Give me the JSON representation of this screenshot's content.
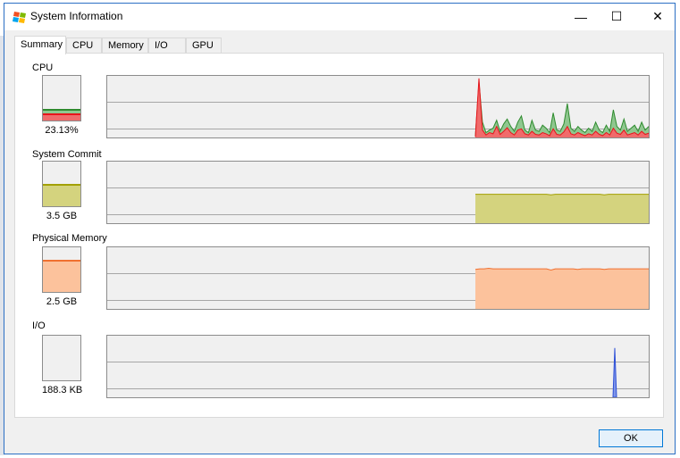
{
  "window": {
    "title": "System Information",
    "icon": "system-info-icon"
  },
  "caption_buttons": {
    "minimize": "—",
    "maximize": "☐",
    "close": "✕"
  },
  "tabs": [
    {
      "label": "Summary",
      "active": true
    },
    {
      "label": "CPU",
      "active": false
    },
    {
      "label": "Memory",
      "active": false
    },
    {
      "label": "I/O",
      "active": false
    },
    {
      "label": "GPU",
      "active": false
    }
  ],
  "sections": {
    "cpu": {
      "label": "CPU",
      "value": "23.13%",
      "level": 0.23,
      "kernel_level": 0.12
    },
    "commit": {
      "label": "System Commit",
      "value": "3.5 GB",
      "level": 0.47
    },
    "physical": {
      "label": "Physical Memory",
      "value": "2.5 GB",
      "level": 0.69
    },
    "io": {
      "label": "I/O",
      "value": "188.3  KB",
      "level": 0
    }
  },
  "colors": {
    "cpu_total": "#2e8b2e",
    "cpu_total_fill": "#8fc78f",
    "cpu_kernel": "#e8141b",
    "cpu_kernel_fill": "#f06b6b",
    "commit_line": "#a3a000",
    "commit_fill": "#d4d37e",
    "physical_line": "#f07030",
    "physical_fill": "#fcc29c",
    "io_line": "#2c4fd6"
  },
  "history": {
    "cpu_total": [
      2,
      90,
      25,
      8,
      12,
      15,
      28,
      10,
      22,
      30,
      18,
      10,
      25,
      35,
      12,
      8,
      28,
      12,
      10,
      20,
      15,
      8,
      40,
      12,
      10,
      22,
      55,
      15,
      10,
      18,
      12,
      8,
      15,
      10,
      25,
      12,
      8,
      20,
      10,
      45,
      18,
      12,
      30,
      10,
      15,
      20,
      10,
      25,
      12,
      18
    ],
    "cpu_kernel": [
      1,
      96,
      12,
      4,
      8,
      6,
      18,
      5,
      10,
      16,
      8,
      4,
      12,
      14,
      6,
      4,
      10,
      5,
      4,
      8,
      6,
      3,
      14,
      5,
      4,
      9,
      18,
      6,
      4,
      8,
      5,
      3,
      6,
      4,
      10,
      5,
      3,
      8,
      4,
      15,
      7,
      5,
      12,
      4,
      6,
      8,
      4,
      10,
      5,
      7
    ],
    "commit": [
      0.47,
      0.47,
      0.47,
      0.47,
      0.47,
      0.47,
      0.47,
      0.47,
      0.47,
      0.47,
      0.47,
      0.47,
      0.47,
      0.47,
      0.47,
      0.47,
      0.47,
      0.46,
      0.47,
      0.47,
      0.47,
      0.47,
      0.47,
      0.47,
      0.47,
      0.47,
      0.47,
      0.47,
      0.47,
      0.46,
      0.47,
      0.47,
      0.47,
      0.47,
      0.47,
      0.47,
      0.47,
      0.47,
      0.47,
      0.47
    ],
    "physical": [
      0.64,
      0.65,
      0.65,
      0.66,
      0.65,
      0.65,
      0.65,
      0.65,
      0.65,
      0.65,
      0.65,
      0.65,
      0.65,
      0.65,
      0.65,
      0.65,
      0.65,
      0.63,
      0.65,
      0.65,
      0.65,
      0.65,
      0.65,
      0.64,
      0.65,
      0.65,
      0.65,
      0.65,
      0.65,
      0.64,
      0.65,
      0.65,
      0.65,
      0.65,
      0.65,
      0.65,
      0.65,
      0.65,
      0.65,
      0.65
    ],
    "io_spike": 0.8
  },
  "ok_label": "OK"
}
